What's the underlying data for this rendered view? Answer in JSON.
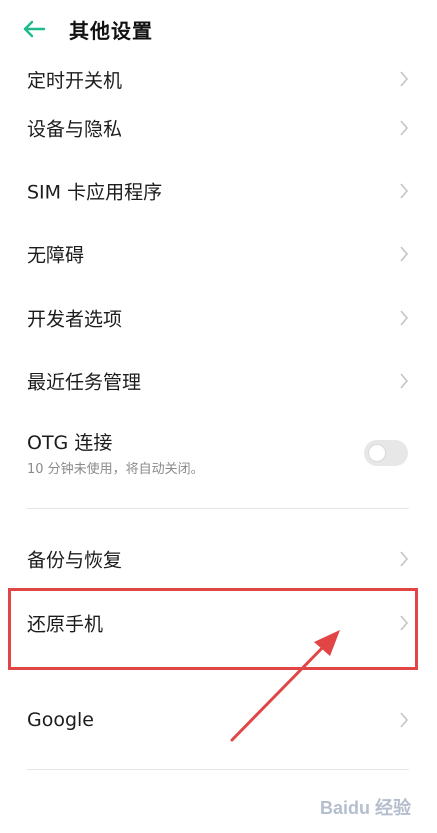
{
  "header": {
    "title": "其他设置",
    "back_icon": "arrow-left-icon",
    "accent_color": "#1eb98c"
  },
  "items": [
    {
      "label": "定时开关机"
    },
    {
      "label": "设备与隐私"
    },
    {
      "label": "SIM 卡应用程序"
    },
    {
      "label": "无障碍"
    },
    {
      "label": "开发者选项"
    },
    {
      "label": "最近任务管理"
    }
  ],
  "otg": {
    "label": "OTG 连接",
    "subtitle": "10 分钟未使用，将自动关闭。",
    "enabled": false
  },
  "items2": [
    {
      "label": "备份与恢复"
    },
    {
      "label": "还原手机"
    },
    {
      "label": "Google"
    }
  ],
  "annotation": {
    "highlight_color": "#e24545",
    "highlighted_item": "还原手机"
  },
  "watermark": "Baidu 经验"
}
